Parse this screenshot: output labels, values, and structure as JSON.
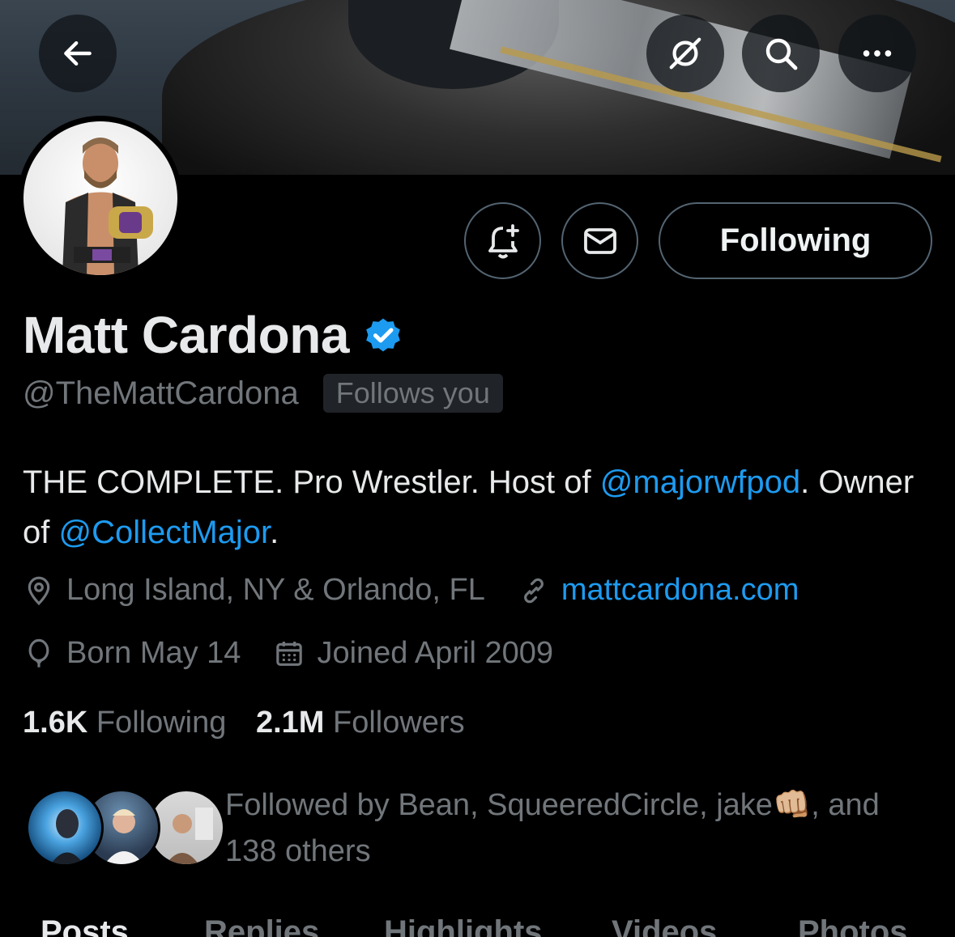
{
  "banner": {
    "back_icon": "arrow-left-icon",
    "grok_icon": "grok-icon",
    "search_icon": "search-icon",
    "more_icon": "more-horizontal-icon"
  },
  "actions": {
    "notify_icon": "bell-plus-icon",
    "message_icon": "envelope-icon",
    "following_label": "Following"
  },
  "profile": {
    "name": "Matt Cardona",
    "handle": "@TheMattCardona",
    "follows_you": "Follows you",
    "bio": {
      "part1": "THE COMPLETE. Pro Wrestler. Host of ",
      "mention1": "@majorwfpod",
      "part2": ". Owner of ",
      "mention2": "@CollectMajor",
      "part3": "."
    },
    "location": "Long Island, NY & Orlando, FL",
    "website": "mattcardona.com",
    "birthday": "Born May 14",
    "joined": "Joined April 2009",
    "following_count": "1.6K",
    "following_label": "Following",
    "followers_count": "2.1M",
    "followers_label": "Followers",
    "followed_by_prefix": "Followed by Bean, SqueeredCircle, jake",
    "followed_by_emoji": "👊🏼",
    "followed_by_suffix": ", and 138 others"
  },
  "tabs": [
    "Posts",
    "Replies",
    "Highlights",
    "Videos",
    "Photos"
  ],
  "colors": {
    "accent": "#1d9bf0",
    "muted": "#71767b",
    "border": "#536471",
    "text": "#e7e9ea"
  }
}
